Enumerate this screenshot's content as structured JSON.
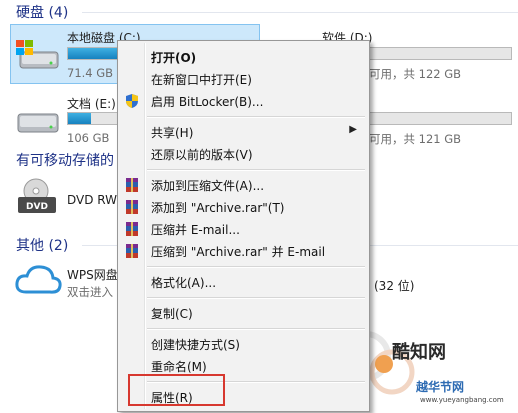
{
  "sections": {
    "hdd": "硬盘 (4)",
    "removable": "有可移动存储的",
    "other": "其他 (2)"
  },
  "drives": {
    "c": {
      "name": "本地磁盘 (C:)",
      "free": "71.4 GB",
      "fill": 0.46
    },
    "d": {
      "name": "软件 (D:)",
      "free_tail": "可用，共 122 GB",
      "fill": 0.0
    },
    "e": {
      "name": "文档 (E:)",
      "free": "106 GB",
      "fill": 0.12
    },
    "f": {
      "free_tail": "可用，共 121 GB"
    },
    "dvd": {
      "name": "DVD RW",
      "icon_text": "DVD"
    },
    "wps": {
      "name": "WPS网盘",
      "sub": "双击进入",
      "tail": "(32 位)"
    }
  },
  "context_menu": {
    "open": "打开(O)",
    "open_new_window": "在新窗口中打开(E)",
    "bitlocker": "启用 BitLocker(B)...",
    "share": "共享(H)",
    "restore": "还原以前的版本(V)",
    "add_archive": "添加到压缩文件(A)...",
    "add_archive_rar": "添加到 \"Archive.rar\"(T)",
    "compress_email": "压缩并 E-mail...",
    "compress_rar_email": "压缩到 \"Archive.rar\" 并 E-mail",
    "format": "格式化(A)...",
    "copy": "复制(C)",
    "create_shortcut": "创建快捷方式(S)",
    "rename": "重命名(M)",
    "properties": "属性(R)"
  },
  "watermark": {
    "brand": "酷知网",
    "brand2": "越华节网",
    "url": "www.yueyangbang.com"
  },
  "colors": {
    "accent": "#1e3287",
    "bar_fill": "#26a0da",
    "highlight": "#d7382f"
  }
}
